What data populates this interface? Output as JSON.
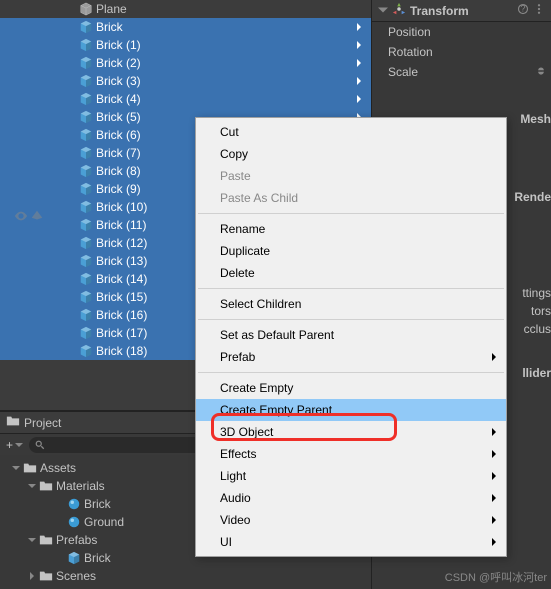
{
  "hierarchy": {
    "items": [
      {
        "label": "Plane",
        "selected": false,
        "indent": 72,
        "icon": "mesh",
        "chev": false
      },
      {
        "label": "Brick",
        "selected": true,
        "indent": 72,
        "icon": "prefab",
        "chev": true
      },
      {
        "label": "Brick (1)",
        "selected": true,
        "indent": 72,
        "icon": "prefab",
        "chev": true
      },
      {
        "label": "Brick (2)",
        "selected": true,
        "indent": 72,
        "icon": "prefab",
        "chev": true
      },
      {
        "label": "Brick (3)",
        "selected": true,
        "indent": 72,
        "icon": "prefab",
        "chev": true
      },
      {
        "label": "Brick (4)",
        "selected": true,
        "indent": 72,
        "icon": "prefab",
        "chev": true
      },
      {
        "label": "Brick (5)",
        "selected": true,
        "indent": 72,
        "icon": "prefab",
        "chev": true
      },
      {
        "label": "Brick (6)",
        "selected": true,
        "indent": 72,
        "icon": "prefab",
        "chev": true
      },
      {
        "label": "Brick (7)",
        "selected": true,
        "indent": 72,
        "icon": "prefab",
        "chev": true
      },
      {
        "label": "Brick (8)",
        "selected": true,
        "indent": 72,
        "icon": "prefab",
        "chev": true
      },
      {
        "label": "Brick (9)",
        "selected": true,
        "indent": 72,
        "icon": "prefab",
        "chev": true
      },
      {
        "label": "Brick (10)",
        "selected": true,
        "indent": 72,
        "icon": "prefab",
        "chev": true
      },
      {
        "label": "Brick (11)",
        "selected": true,
        "indent": 72,
        "icon": "prefab",
        "chev": true
      },
      {
        "label": "Brick (12)",
        "selected": true,
        "indent": 72,
        "icon": "prefab",
        "chev": true
      },
      {
        "label": "Brick (13)",
        "selected": true,
        "indent": 72,
        "icon": "prefab",
        "chev": true
      },
      {
        "label": "Brick (14)",
        "selected": true,
        "indent": 72,
        "icon": "prefab",
        "chev": true
      },
      {
        "label": "Brick (15)",
        "selected": true,
        "indent": 72,
        "icon": "prefab",
        "chev": true
      },
      {
        "label": "Brick (16)",
        "selected": true,
        "indent": 72,
        "icon": "prefab",
        "chev": true
      },
      {
        "label": "Brick (17)",
        "selected": true,
        "indent": 72,
        "icon": "prefab",
        "chev": true
      },
      {
        "label": "Brick (18)",
        "selected": true,
        "indent": 72,
        "icon": "prefab",
        "chev": true
      }
    ]
  },
  "project": {
    "tab": "Project",
    "add": "+",
    "tree": [
      {
        "label": "Assets",
        "indent": 4,
        "icon": "folder",
        "fold": "down"
      },
      {
        "label": "Materials",
        "indent": 20,
        "icon": "folder",
        "fold": "down"
      },
      {
        "label": "Brick",
        "indent": 48,
        "icon": "material",
        "fold": ""
      },
      {
        "label": "Ground",
        "indent": 48,
        "icon": "material",
        "fold": ""
      },
      {
        "label": "Prefabs",
        "indent": 20,
        "icon": "folder",
        "fold": "down"
      },
      {
        "label": "Brick",
        "indent": 48,
        "icon": "prefab",
        "fold": ""
      },
      {
        "label": "Scenes",
        "indent": 20,
        "icon": "folder",
        "fold": "right"
      }
    ]
  },
  "inspector": {
    "transform": {
      "title": "Transform",
      "props": [
        "Position",
        "Rotation",
        "Scale"
      ]
    },
    "stubs": [
      "Mesh",
      "Rende",
      "ttings",
      "tors",
      "cclus",
      "llider"
    ]
  },
  "context_menu": {
    "items": [
      {
        "label": "Cut",
        "disabled": false,
        "sep": false,
        "sub": false,
        "hl": false
      },
      {
        "label": "Copy",
        "disabled": false,
        "sep": false,
        "sub": false,
        "hl": false
      },
      {
        "label": "Paste",
        "disabled": true,
        "sep": false,
        "sub": false,
        "hl": false
      },
      {
        "label": "Paste As Child",
        "disabled": true,
        "sep": false,
        "sub": false,
        "hl": false
      },
      {
        "label": "",
        "disabled": false,
        "sep": true,
        "sub": false,
        "hl": false
      },
      {
        "label": "Rename",
        "disabled": false,
        "sep": false,
        "sub": false,
        "hl": false
      },
      {
        "label": "Duplicate",
        "disabled": false,
        "sep": false,
        "sub": false,
        "hl": false
      },
      {
        "label": "Delete",
        "disabled": false,
        "sep": false,
        "sub": false,
        "hl": false
      },
      {
        "label": "",
        "disabled": false,
        "sep": true,
        "sub": false,
        "hl": false
      },
      {
        "label": "Select Children",
        "disabled": false,
        "sep": false,
        "sub": false,
        "hl": false
      },
      {
        "label": "",
        "disabled": false,
        "sep": true,
        "sub": false,
        "hl": false
      },
      {
        "label": "Set as Default Parent",
        "disabled": false,
        "sep": false,
        "sub": false,
        "hl": false
      },
      {
        "label": "Prefab",
        "disabled": false,
        "sep": false,
        "sub": true,
        "hl": false
      },
      {
        "label": "",
        "disabled": false,
        "sep": true,
        "sub": false,
        "hl": false
      },
      {
        "label": "Create Empty",
        "disabled": false,
        "sep": false,
        "sub": false,
        "hl": false
      },
      {
        "label": "Create Empty Parent",
        "disabled": false,
        "sep": false,
        "sub": false,
        "hl": true
      },
      {
        "label": "3D Object",
        "disabled": false,
        "sep": false,
        "sub": true,
        "hl": false
      },
      {
        "label": "Effects",
        "disabled": false,
        "sep": false,
        "sub": true,
        "hl": false
      },
      {
        "label": "Light",
        "disabled": false,
        "sep": false,
        "sub": true,
        "hl": false
      },
      {
        "label": "Audio",
        "disabled": false,
        "sep": false,
        "sub": true,
        "hl": false
      },
      {
        "label": "Video",
        "disabled": false,
        "sep": false,
        "sub": true,
        "hl": false
      },
      {
        "label": "UI",
        "disabled": false,
        "sep": false,
        "sub": true,
        "hl": false
      }
    ]
  },
  "watermark": "CSDN @呼叫冰河ter"
}
